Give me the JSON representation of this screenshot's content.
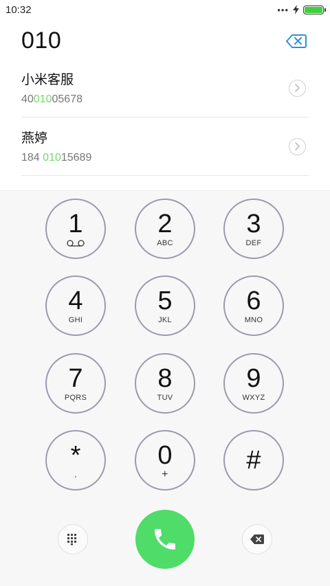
{
  "status_bar": {
    "time": "10:32",
    "dots": "•••"
  },
  "dialer": {
    "entered_number": "010"
  },
  "contacts": [
    {
      "name": "小米客服",
      "number_prefix": "40",
      "number_match": "010",
      "number_suffix": "05678"
    },
    {
      "name": "燕婷",
      "number_prefix": "184 ",
      "number_match": "010",
      "number_suffix": "15689"
    }
  ],
  "keypad": [
    {
      "digit": "1",
      "sub": ""
    },
    {
      "digit": "2",
      "sub": "ABC"
    },
    {
      "digit": "3",
      "sub": "DEF"
    },
    {
      "digit": "4",
      "sub": "GHI"
    },
    {
      "digit": "5",
      "sub": "JKL"
    },
    {
      "digit": "6",
      "sub": "MNO"
    },
    {
      "digit": "7",
      "sub": "PQRS"
    },
    {
      "digit": "8",
      "sub": "TUV"
    },
    {
      "digit": "9",
      "sub": "WXYZ"
    },
    {
      "digit": "*",
      "sub": ","
    },
    {
      "digit": "0",
      "sub": "+"
    },
    {
      "digit": "#",
      "sub": ""
    }
  ],
  "colors": {
    "match_highlight": "#73d96a",
    "call_button": "#4fdc69",
    "delete_icon_blue": "#2e8fe0",
    "key_ring": "#9d98ab",
    "battery": "#3fcf3f"
  },
  "icons": {
    "delete_top": "backspace-icon",
    "chevron": "chevron-right-icon",
    "voicemail": "voicemail-icon",
    "collapse_keypad": "keypad-grid-icon",
    "call": "phone-icon",
    "delete_bottom": "backspace-icon"
  }
}
